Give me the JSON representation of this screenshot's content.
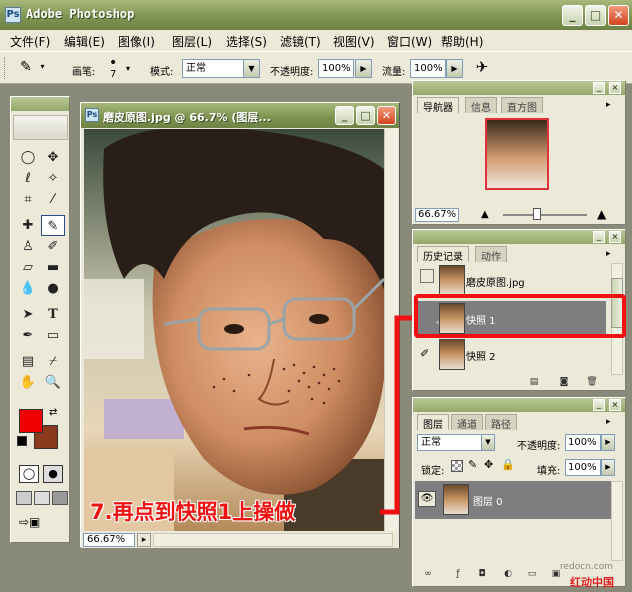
{
  "app": {
    "title": "Adobe Photoshop",
    "icon": "ps-icon"
  },
  "window_controls": {
    "minimize": "_",
    "maximize": "□",
    "close": "✕"
  },
  "menu": [
    "文件(F)",
    "编辑(E)",
    "图像(I)",
    "图层(L)",
    "选择(S)",
    "滤镜(T)",
    "视图(V)",
    "窗口(W)",
    "帮助(H)"
  ],
  "options": {
    "brush_label": "画笔:",
    "brush_size": "7",
    "mode_label": "模式:",
    "mode_value": "正常",
    "opacity_label": "不透明度:",
    "opacity_value": "100%",
    "flow_label": "流量:",
    "flow_value": "100%"
  },
  "document": {
    "title": "磨皮原图.jpg @ 66.7% (图层...",
    "zoom": "66.67%"
  },
  "navigator": {
    "tabs": [
      "导航器",
      "信息",
      "直方图"
    ],
    "zoom": "66.67%"
  },
  "history": {
    "tabs": [
      "历史记录",
      "动作"
    ],
    "items": [
      {
        "label": "磨皮原图.jpg"
      },
      {
        "label": "快照 1"
      },
      {
        "label": "快照 2"
      }
    ]
  },
  "layers": {
    "tabs": [
      "图层",
      "通道",
      "路径"
    ],
    "blend_mode": "正常",
    "opacity_label": "不透明度:",
    "opacity_value": "100%",
    "lock_label": "锁定:",
    "fill_label": "填充:",
    "fill_value": "100%",
    "layer_name": "图层 0"
  },
  "annotation": {
    "text": "7.再点到快照1上操做",
    "color": "#f01010"
  },
  "watermark": {
    "url": "redocn.com",
    "name": "红动中国"
  },
  "colors": {
    "foreground": "#f00000",
    "background": "#8b3a1e",
    "accent": "#f01010"
  }
}
